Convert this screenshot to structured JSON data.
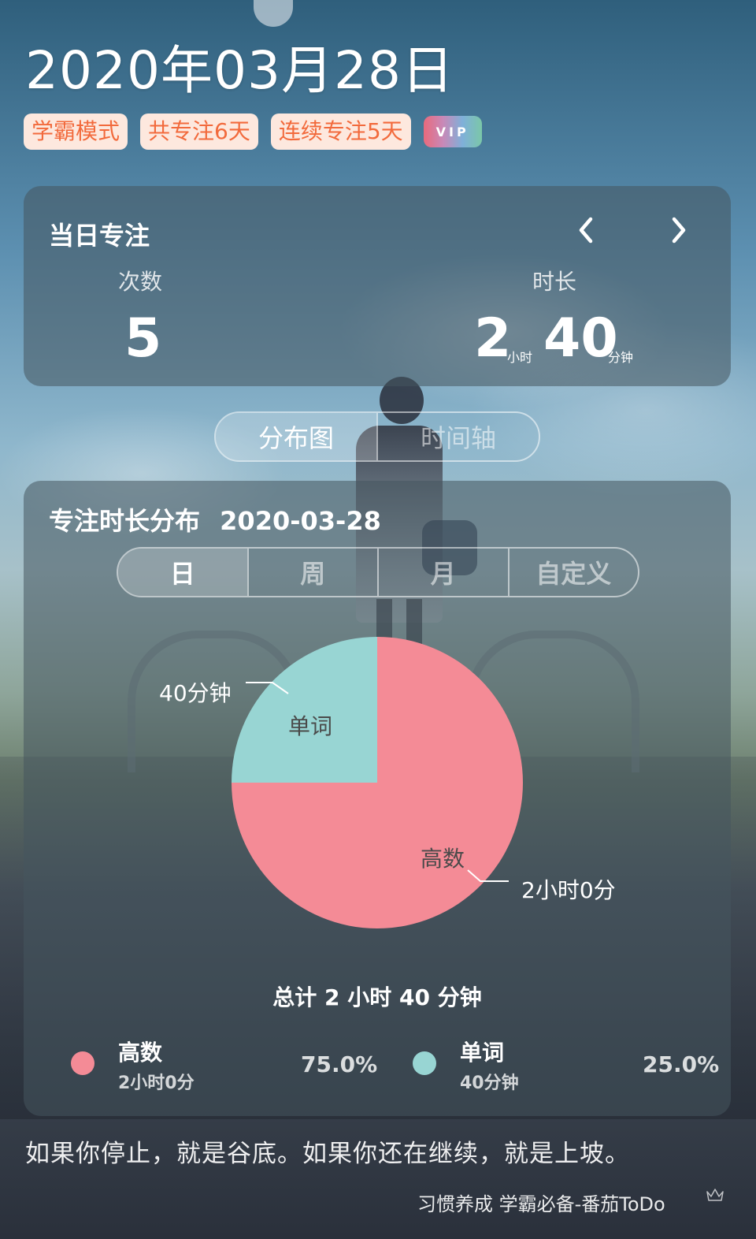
{
  "header": {
    "date": "2020年03月28日",
    "tags": [
      "学霸模式",
      "共专注6天",
      "连续专注5天"
    ],
    "vip_label": "VIP"
  },
  "daily": {
    "title": "当日专注",
    "count_label": "次数",
    "count_value": "5",
    "duration_label": "时长",
    "hours": "2",
    "hours_unit": "小时",
    "minutes": "40",
    "minutes_unit": "分钟"
  },
  "view_tabs": [
    "分布图",
    "时间轴"
  ],
  "view_active": "分布图",
  "distribution": {
    "title": "专注时长分布",
    "date": "2020-03-28",
    "range_tabs": [
      "日",
      "周",
      "月",
      "自定义"
    ],
    "range_active": "日",
    "total": "总计 2 小时 40 分钟"
  },
  "chart_data": {
    "type": "pie",
    "slices": [
      {
        "name": "高数",
        "value": 75.0,
        "color": "#f48b96",
        "duration": "2小时0分",
        "legend_duration": "2小时0分",
        "percent": "75.0%"
      },
      {
        "name": "单词",
        "value": 25.0,
        "color": "#98d5d3",
        "duration": "40分钟",
        "legend_duration": "40分钟",
        "percent": "25.0%"
      }
    ]
  },
  "quote": "如果你停止，就是谷底。如果你还在继续，就是上坡。",
  "footer": "习惯养成 学霸必备-番茄ToDo"
}
